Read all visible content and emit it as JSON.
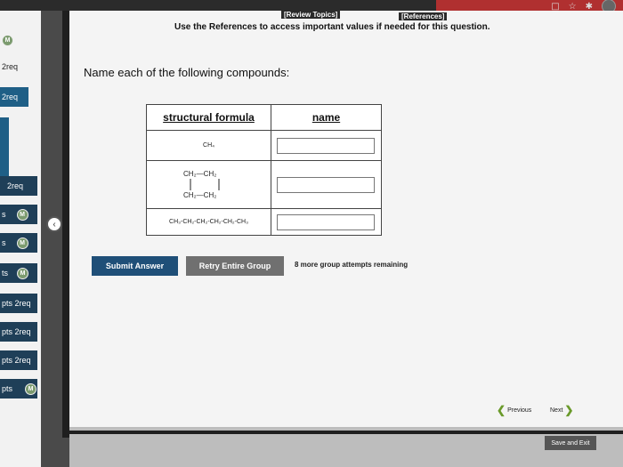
{
  "header": {
    "review_topics": "[Review Topics]",
    "references": "[References]",
    "use_references": "Use the References to access important values if needed for this question."
  },
  "question": {
    "prompt": "Name each of the following compounds:",
    "table": {
      "col_formula": "structural formula",
      "col_name": "name",
      "rows": [
        {
          "formula": "CH₄",
          "name_value": ""
        },
        {
          "formula_lines": [
            "CH₂—CH₂",
            "CH₂—CH₂"
          ],
          "name_value": ""
        },
        {
          "formula": "CH₃-CH₂-CH₂-CH₂-CH₂-CH₃",
          "name_value": ""
        }
      ]
    }
  },
  "actions": {
    "submit": "Submit Answer",
    "retry": "Retry Entire Group",
    "attempts": "8 more group attempts remaining"
  },
  "nav": {
    "previous": "Previous",
    "next": "Next",
    "save_exit": "Save and Exit"
  },
  "sidebar": {
    "items": [
      {
        "label": "M"
      },
      {
        "label": "2req"
      },
      {
        "label": "2req"
      },
      {
        "label": "2req"
      },
      {
        "label": "s",
        "badge": "M"
      },
      {
        "label": "s",
        "badge": "M"
      },
      {
        "label": "ts",
        "badge": "M"
      },
      {
        "label": "pts 2req"
      },
      {
        "label": "pts 2req"
      },
      {
        "label": "pts 2req"
      },
      {
        "label": "pts",
        "badge": "M"
      }
    ]
  },
  "colors": {
    "accent": "#1f4f78",
    "secondary_button": "#707070",
    "nav_chevron": "#6a9a2a",
    "badge": "#7c9b6f"
  }
}
